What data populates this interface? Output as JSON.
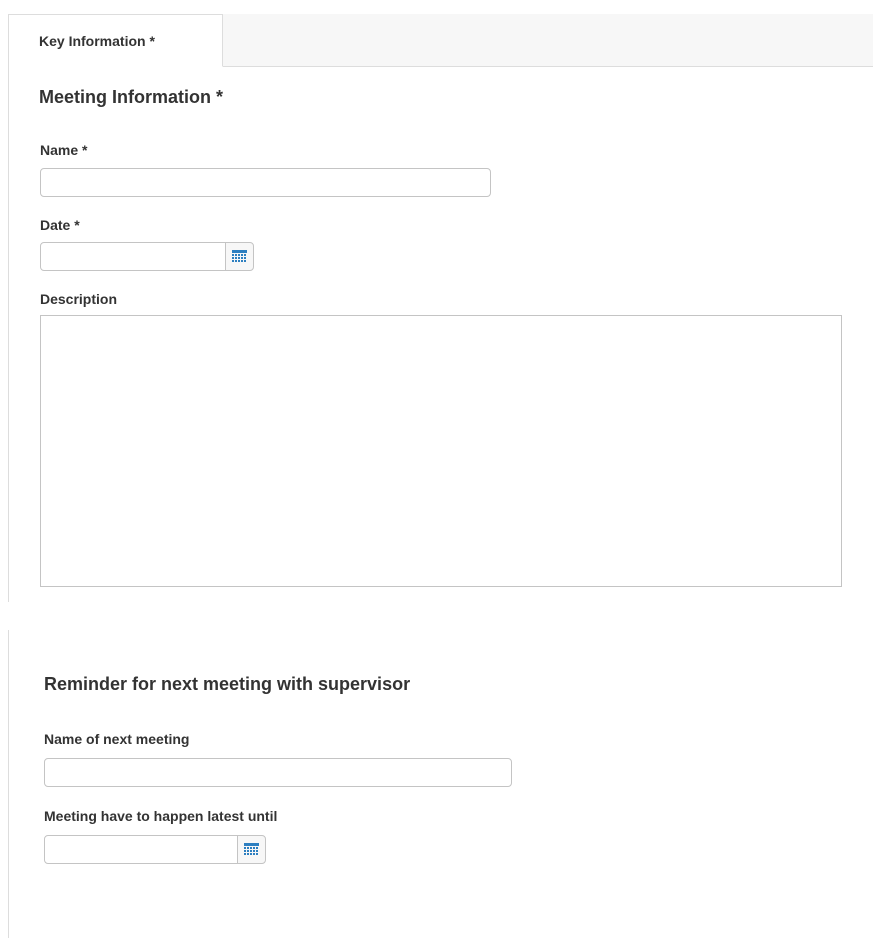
{
  "tabs": [
    {
      "label": "Key Information *",
      "active": true
    }
  ],
  "meeting_info": {
    "heading": "Meeting Information *",
    "name": {
      "label": "Name *",
      "value": ""
    },
    "date": {
      "label": "Date *",
      "value": ""
    },
    "description": {
      "label": "Description",
      "value": ""
    }
  },
  "reminder": {
    "heading": "Reminder for next meeting with supervisor",
    "next_meeting_name": {
      "label": "Name of next meeting",
      "value": ""
    },
    "deadline": {
      "label": "Meeting have to happen latest until",
      "value": ""
    }
  },
  "icons": {
    "calendar": "calendar-icon"
  },
  "colors": {
    "calendar_icon": "#2d7fc0",
    "border": "#c4c4c4",
    "tab_strip_bg": "#f7f7f7"
  }
}
